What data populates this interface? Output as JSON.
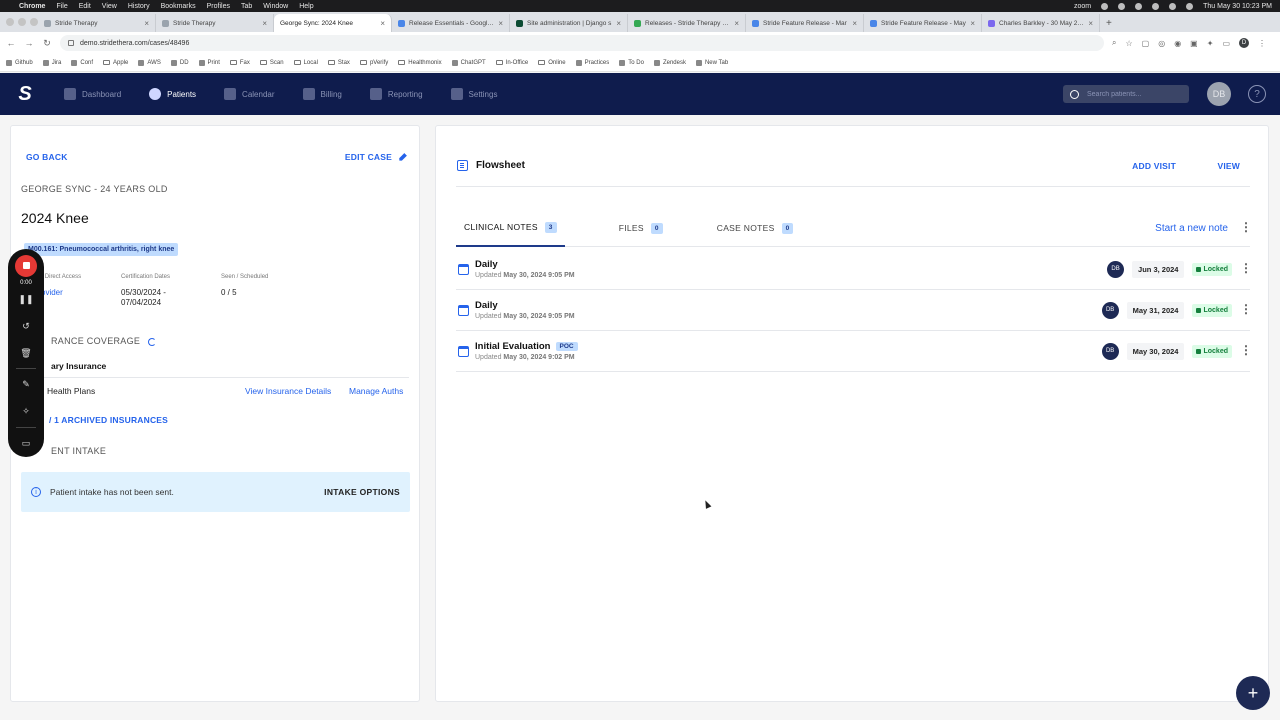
{
  "menubar": {
    "app": "Chrome",
    "items": [
      "File",
      "Edit",
      "View",
      "History",
      "Bookmarks",
      "Profiles",
      "Tab",
      "Window",
      "Help"
    ],
    "zoom": "zoom",
    "clock": "Thu May 30  10:23 PM"
  },
  "tabs": [
    {
      "title": "Stride Therapy",
      "icon": "favicon"
    },
    {
      "title": "Stride Therapy",
      "icon": "favicon"
    },
    {
      "title": "George Sync: 2024 Knee",
      "icon": "favicon",
      "active": true
    },
    {
      "title": "Release Essentials - Google D",
      "icon": "google-docs-icon"
    },
    {
      "title": "Site administration | Django s",
      "icon": "django-icon"
    },
    {
      "title": "Releases - Stride Therapy - G",
      "icon": "google-drive-icon"
    },
    {
      "title": "Stride Feature Release - Mar",
      "icon": "google-docs-icon"
    },
    {
      "title": "Stride Feature Release - May",
      "icon": "google-docs-icon"
    },
    {
      "title": "Charles Barkley - 30 May 202",
      "icon": "clickup-icon"
    }
  ],
  "address": {
    "url": "demo.stridethera.com/cases/48496",
    "profile": "D"
  },
  "bookmarks": [
    {
      "label": "Github",
      "icon": "github-icon"
    },
    {
      "label": "Jira",
      "icon": "jira-icon"
    },
    {
      "label": "Conf",
      "icon": "confluence-icon"
    },
    {
      "label": "Apple",
      "icon": "folder-icon"
    },
    {
      "label": "AWS",
      "icon": "aws-icon"
    },
    {
      "label": "DD",
      "icon": "datadog-icon"
    },
    {
      "label": "Print",
      "icon": "printer-icon"
    },
    {
      "label": "Fax",
      "icon": "folder-icon"
    },
    {
      "label": "Scan",
      "icon": "folder-icon"
    },
    {
      "label": "Local",
      "icon": "folder-icon"
    },
    {
      "label": "Stax",
      "icon": "folder-icon"
    },
    {
      "label": "pVerify",
      "icon": "folder-icon"
    },
    {
      "label": "Healthmonix",
      "icon": "folder-icon"
    },
    {
      "label": "ChatGPT",
      "icon": "chatgpt-icon"
    },
    {
      "label": "In-Office",
      "icon": "folder-icon"
    },
    {
      "label": "Online",
      "icon": "folder-icon"
    },
    {
      "label": "Practices",
      "icon": "sheets-icon"
    },
    {
      "label": "To Do",
      "icon": "todo-icon"
    },
    {
      "label": "Zendesk",
      "icon": "zendesk-icon"
    },
    {
      "label": "New Tab",
      "icon": "globe-icon"
    }
  ],
  "header": {
    "nav": [
      {
        "label": "Dashboard",
        "icon": "dashboard-icon"
      },
      {
        "label": "Patients",
        "icon": "patients-icon",
        "active": true
      },
      {
        "label": "Calendar",
        "icon": "calendar-icon"
      },
      {
        "label": "Billing",
        "icon": "billing-icon"
      },
      {
        "label": "Reporting",
        "icon": "reporting-icon"
      },
      {
        "label": "Settings",
        "icon": "settings-icon"
      }
    ],
    "search_placeholder": "Search patients...",
    "user_initials": "DB",
    "help": "?"
  },
  "case": {
    "go_back": "GO BACK",
    "edit_case": "EDIT CASE",
    "patient_line": "GEORGE SYNC - 24 YEARS OLD",
    "title": "2024 Knee",
    "diagnosis": "M00.161: Pneumococcal arthritis, right knee",
    "meta": [
      {
        "label": "by • Direct Access",
        "value": "ovider"
      },
      {
        "label": "Certification Dates",
        "value": "05/30/2024 -",
        "value2": "07/04/2024"
      },
      {
        "label": "Seen / Scheduled",
        "value": "0 / 5"
      }
    ],
    "insurance_heading": "RANCE COVERAGE",
    "insurance_title": "ary Insurance",
    "insurance_plan": "Health Plans",
    "view_insurance": "View Insurance Details",
    "manage_auths": "Manage Auths",
    "archived": "/ 1 ARCHIVED INSURANCES",
    "intake_heading": "ENT INTAKE",
    "intake_message": "Patient intake has not been sent.",
    "intake_options": "INTAKE OPTIONS"
  },
  "recorder": {
    "time": "0:00"
  },
  "flowsheet": {
    "title": "Flowsheet",
    "add_visit": "ADD VISIT",
    "view": "VIEW",
    "tabs": [
      {
        "label": "CLINICAL NOTES",
        "count": "3",
        "active": true
      },
      {
        "label": "FILES",
        "count": "0"
      },
      {
        "label": "CASE NOTES",
        "count": "0"
      }
    ],
    "new_note": "Start a new note",
    "notes": [
      {
        "title": "Daily",
        "badge": "",
        "updated_prefix": "Updated",
        "updated": "May 30, 2024 9:05 PM",
        "initials": "DB",
        "date": "Jun 3, 2024",
        "status": "Locked"
      },
      {
        "title": "Daily",
        "badge": "",
        "updated_prefix": "Updated",
        "updated": "May 30, 2024 9:05 PM",
        "initials": "DB",
        "date": "May 31, 2024",
        "status": "Locked"
      },
      {
        "title": "Initial Evaluation",
        "badge": "POC",
        "updated_prefix": "Updated",
        "updated": "May 30, 2024 9:02 PM",
        "initials": "DB",
        "date": "May 30, 2024",
        "status": "Locked"
      }
    ],
    "fab": "+"
  }
}
